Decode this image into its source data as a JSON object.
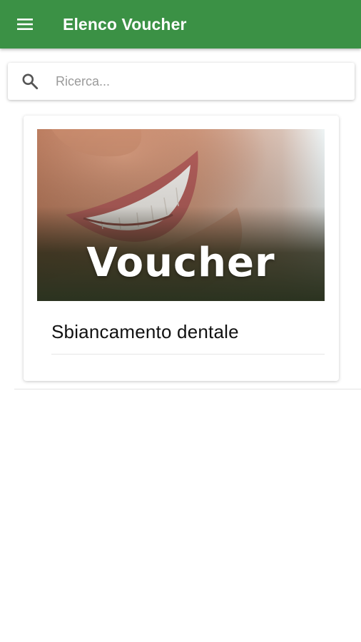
{
  "appbar": {
    "title": "Elenco Voucher",
    "menu_icon": "menu-icon",
    "background_color": "#3b9145"
  },
  "search": {
    "placeholder": "Ricerca...",
    "value": "",
    "icon": "search-icon"
  },
  "vouchers": [
    {
      "image_text": "Voucher",
      "title": "Sbiancamento dentale"
    }
  ]
}
